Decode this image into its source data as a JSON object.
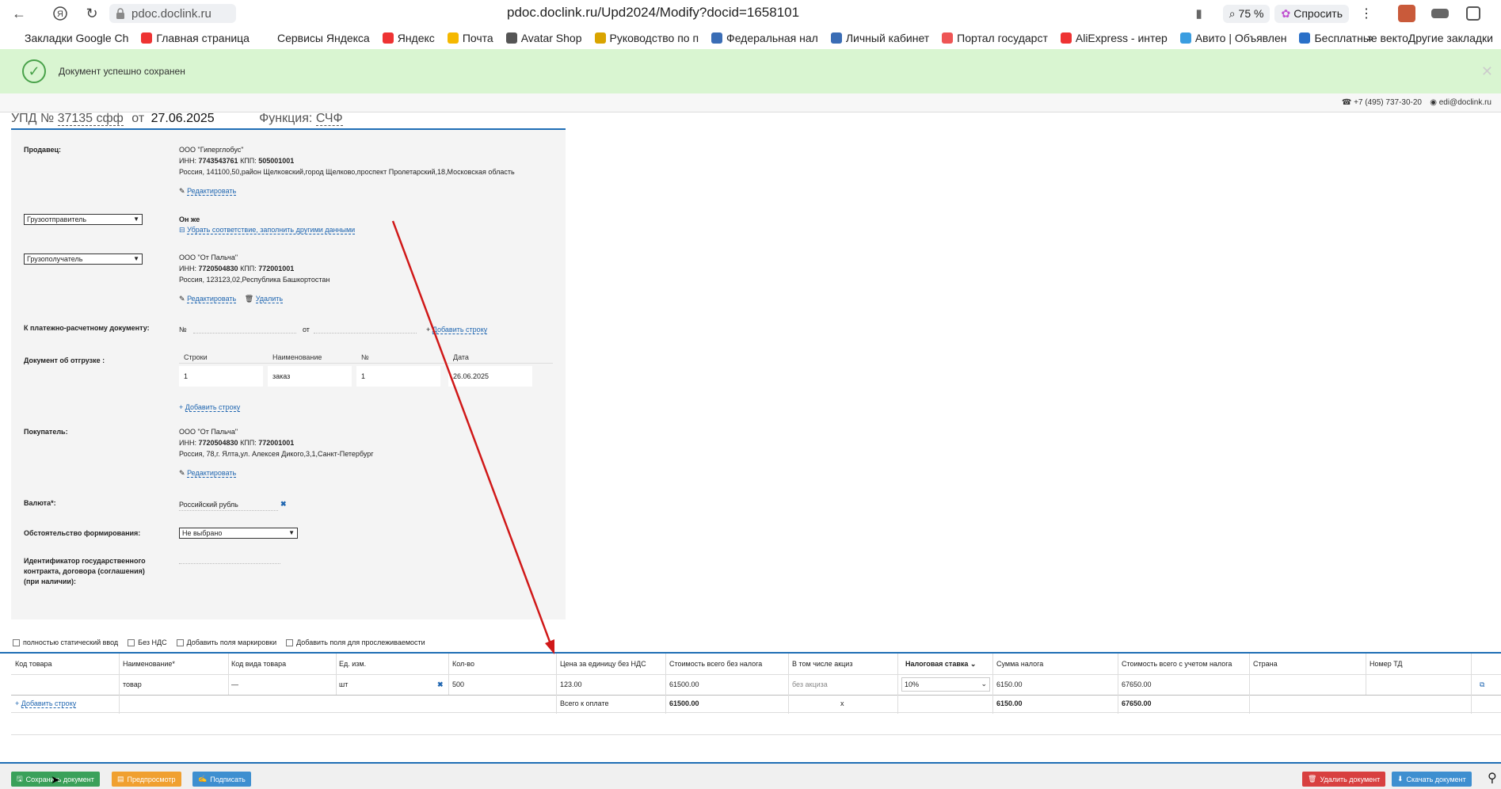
{
  "browser": {
    "host": "pdoc.doclink.ru",
    "url": "pdoc.doclink.ru/Upd2024/Modify?docid=1658101",
    "zoom": "75 %",
    "ask_label": "Спросить"
  },
  "bookmarks": [
    {
      "label": "Закладки Google Ch",
      "color": "#ffffff"
    },
    {
      "label": "Главная страница",
      "color": "#e33"
    },
    {
      "label": "Сервисы Яндекса",
      "color": "#ffffff"
    },
    {
      "label": "Яндекс",
      "color": "#e33"
    },
    {
      "label": "Почта",
      "color": "#f5b800"
    },
    {
      "label": "Avatar Shop",
      "color": "#555"
    },
    {
      "label": "Руководство по п",
      "color": "#d9a400"
    },
    {
      "label": "Федеральная нал",
      "color": "#3a6db5"
    },
    {
      "label": "Личный кабинет",
      "color": "#3a6db5"
    },
    {
      "label": "Портал государст",
      "color": "#e55"
    },
    {
      "label": "AliExpress - интер",
      "color": "#e33"
    },
    {
      "label": "Авито | Объявлен",
      "color": "#3a9de0"
    },
    {
      "label": "Бесплатные векто",
      "color": "#2a70c8"
    }
  ],
  "bookmarks_other": "Другие закладки",
  "alert": {
    "message": "Документ успешно сохранен"
  },
  "contacts": {
    "phone": "+7 (495) 737-30-20",
    "email": "edi@doclink.ru"
  },
  "doc": {
    "prefix": "УПД №",
    "number": "37135 сфф",
    "from": "от",
    "date": "27.06.2025",
    "function_label": "Функция:",
    "function_value": "СЧФ"
  },
  "form": {
    "seller_label": "Продавец:",
    "seller_name": "ООО \"Гиперглобус\"",
    "seller_inn_label": "ИНН:",
    "seller_inn": "7743543761",
    "seller_kpp_label": "КПП:",
    "seller_kpp": "505001001",
    "seller_address": "Россия, 141100,50,район Щелковский,город Щелково,проспект Пролетарский,18,Московская область",
    "edit_label": "Редактировать",
    "delete_label": "Удалить",
    "shipper_select": "Грузоотправитель",
    "shipper_same": "Он же",
    "shipper_unlink": "Убрать соответствие, заполнить другими данными",
    "consignee_select": "Грузополучатель",
    "consignee_name": "ООО \"От Пальча\"",
    "consignee_inn": "7720504830",
    "consignee_kpp": "772001001",
    "consignee_address": "Россия, 123123,02,Республика Башкортостан",
    "payment_label": "К платежно-расчетному документу:",
    "payment_no": "№",
    "payment_from": "от",
    "add_row": "Добавить строку",
    "shipment_label": "Документ об отгрузке :",
    "shipment_cols": [
      "Строки",
      "Наименование",
      "№",
      "Дата"
    ],
    "shipment_row": [
      "1",
      "заказ",
      "1",
      "26.06.2025"
    ],
    "buyer_label": "Покупатель:",
    "buyer_name": "ООО \"От Пальча\"",
    "buyer_inn": "7720504830",
    "buyer_kpp": "772001001",
    "buyer_address": "Россия, 78,г. Ялта,ул. Алексея Дикого,3,1,Санкт-Петербург",
    "currency_label": "Валюта*:",
    "currency_value": "Российский рубль",
    "circumstance_label": "Обстоятельство формирования:",
    "circumstance_value": "Не выбрано",
    "contract_label_1": "Идентификатор государственного",
    "contract_label_2": "контракта, договора (соглашения)",
    "contract_label_3": "(при наличии):"
  },
  "checkboxes": [
    "полностью статический ввод",
    "Без НДС",
    "Добавить поля маркировки",
    "Добавить поля для прослеживаемости"
  ],
  "grid": {
    "headers": [
      "Код товара",
      "Наименование*",
      "Код вида товара",
      "Ед. изм.",
      "Кол-во",
      "Цена за единицу без НДС",
      "Стоимость всего без налога",
      "В том числе акциз",
      "Налоговая ставка",
      "Сумма налога",
      "Стоимость всего с учетом налога",
      "Страна",
      "Номер ТД"
    ],
    "row": {
      "code": "",
      "name": "товар",
      "kind": "—",
      "unit": "шт",
      "qty": "500",
      "price": "123.00",
      "sum_no_tax": "61500.00",
      "excise": "без акциза",
      "rate": "10%",
      "tax": "6150.00",
      "sum_with_tax": "67650.00",
      "country": "",
      "td": ""
    },
    "total_label": "Всего к оплате",
    "total_no_tax": "61500.00",
    "total_excise": "x",
    "total_tax": "6150.00",
    "total_with_tax": "67650.00"
  },
  "actions": {
    "save": "Сохранить документ",
    "preview": "Предпросмотр",
    "sign": "Подписать",
    "delete": "Удалить документ",
    "download": "Скачать документ"
  },
  "colors": {
    "accent": "#1f6eb5",
    "success_bg": "#d9f5d1",
    "arrow": "#d01818"
  }
}
